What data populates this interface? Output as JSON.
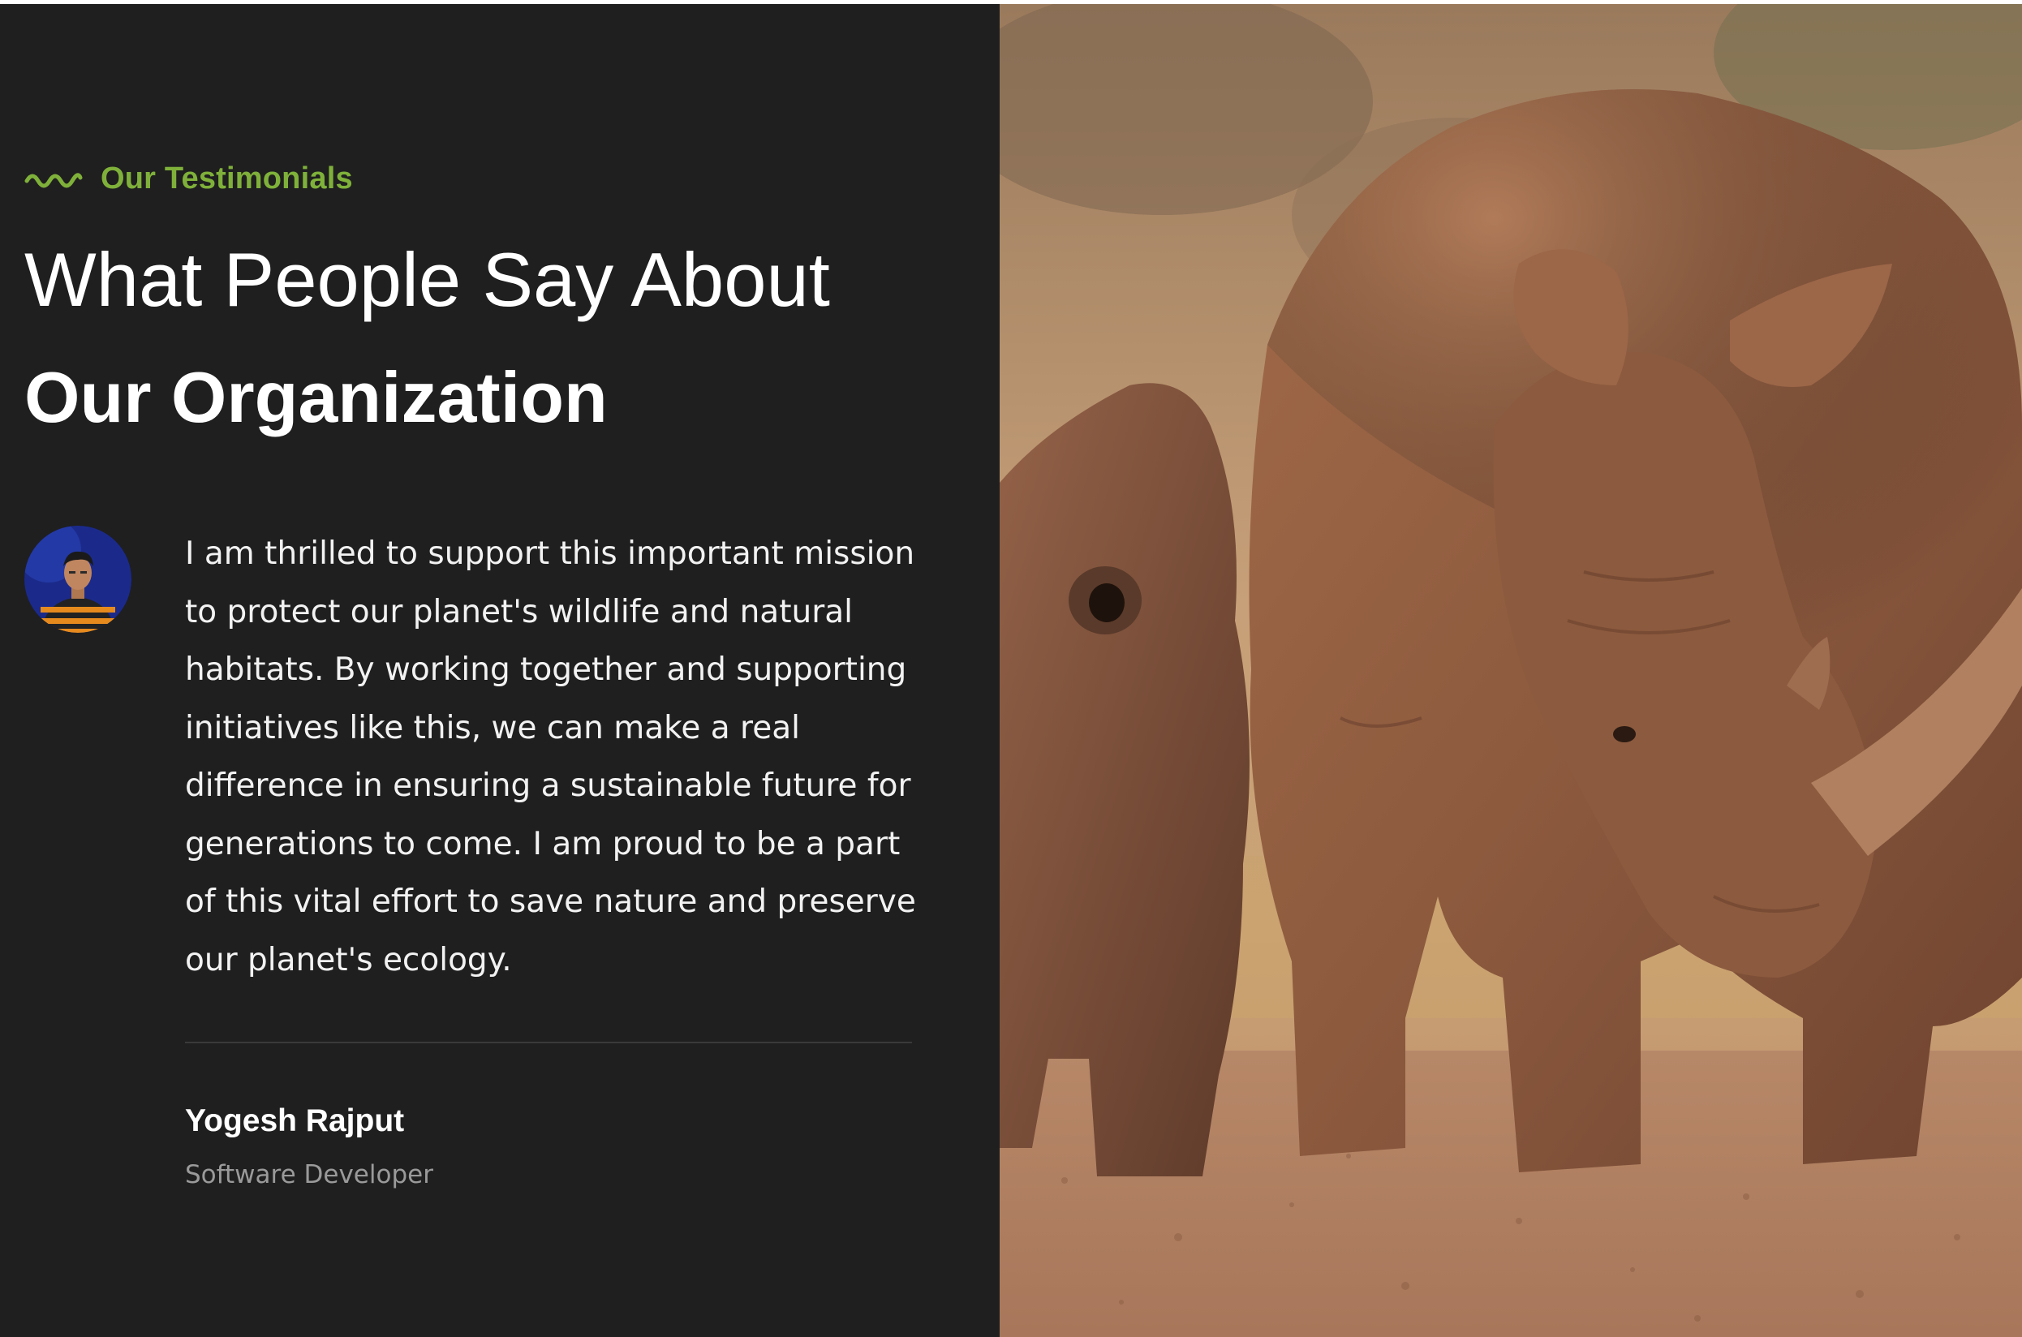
{
  "testimonials": {
    "eyebrow": {
      "label": "Our Testimonials",
      "icon": "wave-icon",
      "color": "#7fb13a"
    },
    "heading": {
      "line1": "What People Say About",
      "line2": "Our Organization"
    },
    "testimonial": {
      "quote": "I am thrilled to support this important mission to protect our planet's wildlife and natural habitats. By working together and supporting initiatives like this, we can make a real difference in ensuring a sustainable future for generations to come. I am proud to be a part of this vital effort to save nature and preserve our planet's ecology.",
      "author_name": "Yogesh Rajput",
      "author_role": "Software Developer",
      "avatar_icon": "avatar-photo"
    }
  },
  "colors": {
    "panel_background": "#1f1f1f",
    "accent": "#7fb13a",
    "text": "#ffffff",
    "muted_text": "#9a9a9a"
  },
  "photo": {
    "subject": "rhinoceros-photo"
  }
}
